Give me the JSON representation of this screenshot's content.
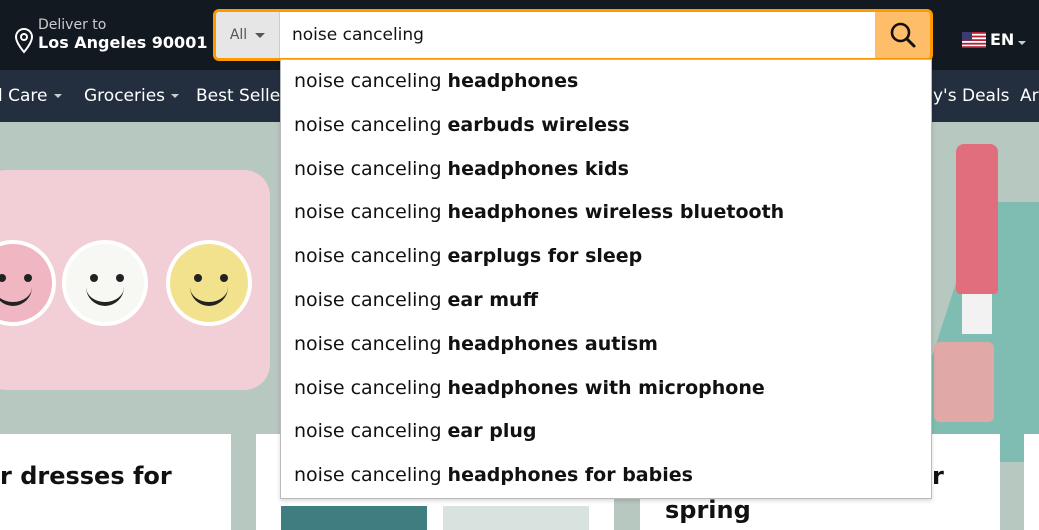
{
  "header": {
    "deliver_label": "Deliver to",
    "deliver_location": "Los Angeles 90001",
    "language": "EN"
  },
  "search": {
    "department": "All",
    "query": "noise canceling",
    "accent_color": "#febd69",
    "border_color": "#ff9900"
  },
  "subnav": {
    "items": [
      "l Care",
      "Groceries",
      "Best Seller",
      "y's Deals",
      "Ar"
    ]
  },
  "suggestions": [
    {
      "prefix": "noise canceling ",
      "suffix": "headphones"
    },
    {
      "prefix": "noise canceling ",
      "suffix": "earbuds wireless"
    },
    {
      "prefix": "noise canceling ",
      "suffix": "headphones kids"
    },
    {
      "prefix": "noise canceling ",
      "suffix": "headphones wireless bluetooth"
    },
    {
      "prefix": "noise canceling ",
      "suffix": "earplugs for sleep"
    },
    {
      "prefix": "noise canceling ",
      "suffix": "ear muff"
    },
    {
      "prefix": "noise canceling ",
      "suffix": "headphones autism"
    },
    {
      "prefix": "noise canceling ",
      "suffix": "headphones with microphone"
    },
    {
      "prefix": "noise canceling ",
      "suffix": "ear plug"
    },
    {
      "prefix": "noise canceling ",
      "suffix": "headphones for babies"
    }
  ],
  "cards": {
    "card1_title": "r dresses for",
    "card3_title_line1": "r",
    "card3_title_line2": "spring"
  },
  "icons": {
    "location": "location-pin-icon",
    "search": "search-icon",
    "flag": "us-flag-icon"
  }
}
